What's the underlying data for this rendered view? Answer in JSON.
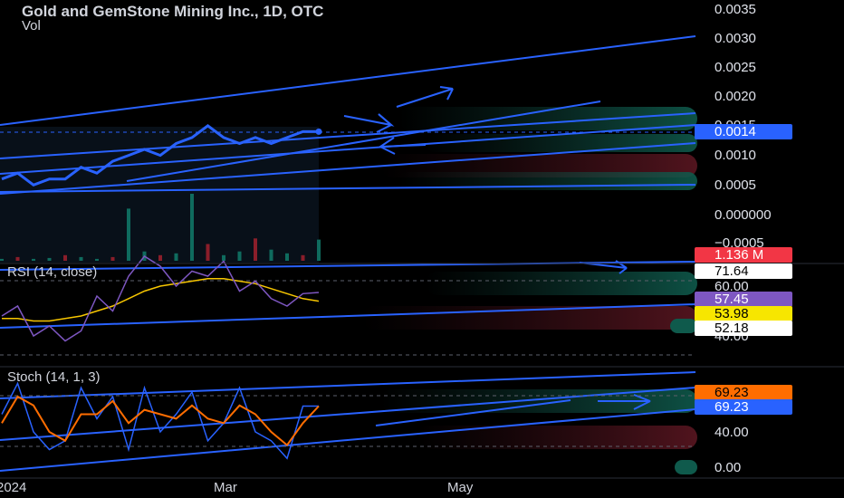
{
  "header": {
    "title": "Gold and GemStone Mining Inc., 1D, OTC",
    "vol_label": "Vol"
  },
  "indicators": {
    "rsi_label": "RSI (14, close)",
    "stoch_label": "Stoch (14, 1, 3)"
  },
  "price_axis": {
    "ticks": [
      "0.0035",
      "0.0030",
      "0.0025",
      "0.0020",
      "0.0015",
      "0.0010",
      "0.0005",
      "0.000000",
      "−0.0005"
    ]
  },
  "rsi_axis": {
    "ticks": [
      "60.00",
      "40.00"
    ]
  },
  "stoch_axis": {
    "ticks": [
      "40.00",
      "0.00"
    ]
  },
  "badges": {
    "price": {
      "text": "0.0014",
      "bg": "#2962ff",
      "fg": "#ffffff"
    },
    "volume": {
      "text": "1.136 M",
      "bg": "#f23645",
      "fg": "#ffffff"
    },
    "rsi_high": {
      "text": "71.64",
      "bg": "#ffffff",
      "fg": "#000000"
    },
    "rsi": {
      "text": "57.45",
      "bg": "#7e57c2",
      "fg": "#ffffff"
    },
    "rsi_ma": {
      "text": "53.98",
      "bg": "#f7e600",
      "fg": "#000000"
    },
    "rsi_low": {
      "text": "52.18",
      "bg": "#ffffff",
      "fg": "#000000"
    },
    "stoch_d": {
      "text": "69.23",
      "bg": "#ff6d00",
      "fg": "#000000"
    },
    "stoch_k": {
      "text": "69.23",
      "bg": "#2962ff",
      "fg": "#ffffff"
    }
  },
  "time_axis": {
    "ticks": [
      "2024",
      "Mar",
      "May"
    ]
  },
  "colors": {
    "price_line": "#2962ff",
    "rsi_line": "#7e57c2",
    "rsi_ma": "#f7c600",
    "stoch_k": "#2962ff",
    "stoch_d": "#ff6d00",
    "vol_up": "#0f6b5e",
    "vol_down": "#8a1e2a"
  },
  "chart_data": [
    {
      "type": "line",
      "name": "price",
      "x": [
        "2024-01-01",
        "2024-01-04",
        "2024-01-09",
        "2024-01-12",
        "2024-01-17",
        "2024-01-22",
        "2024-01-25",
        "2024-01-30",
        "2024-02-02",
        "2024-02-07",
        "2024-02-12",
        "2024-02-15",
        "2024-02-20",
        "2024-02-23",
        "2024-02-28",
        "2024-03-04",
        "2024-03-07",
        "2024-03-12",
        "2024-03-15",
        "2024-03-20",
        "2024-03-25"
      ],
      "values": [
        0.0006,
        0.0007,
        0.0005,
        0.0006,
        0.0006,
        0.0008,
        0.0007,
        0.0009,
        0.001,
        0.0011,
        0.001,
        0.0012,
        0.0013,
        0.0015,
        0.0013,
        0.0012,
        0.0013,
        0.0012,
        0.0013,
        0.0014,
        0.0014
      ],
      "yticks": [
        0.0035,
        0.003,
        0.0025,
        0.002,
        0.0015,
        0.001,
        0.0005,
        0.0,
        -0.0005
      ],
      "last": 0.0014
    },
    {
      "type": "bar",
      "name": "volume",
      "values": [
        0.1,
        0.2,
        0.1,
        0.15,
        0.3,
        0.2,
        0.1,
        0.2,
        2.8,
        0.5,
        0.3,
        0.4,
        3.6,
        0.9,
        0.3,
        0.5,
        1.2,
        0.6,
        0.4,
        0.3,
        1.136
      ],
      "last": 1.136
    },
    {
      "type": "line",
      "name": "RSI (14, close)",
      "values": [
        48,
        52,
        40,
        44,
        38,
        42,
        56,
        50,
        64,
        72,
        68,
        60,
        66,
        64,
        70,
        58,
        62,
        55,
        52,
        57,
        57.45
      ],
      "ma": [
        47,
        47,
        46,
        46,
        47,
        48,
        50,
        52,
        55,
        58,
        60,
        61,
        62,
        63,
        63,
        62,
        61,
        59,
        57,
        55,
        53.98
      ],
      "yticks": [
        60,
        40
      ],
      "levels": {
        "upper": 71.64,
        "lower": 52.18
      }
    },
    {
      "type": "line",
      "name": "Stoch (14, 1, 3)",
      "k": [
        60,
        95,
        40,
        20,
        30,
        90,
        55,
        80,
        20,
        90,
        40,
        60,
        85,
        30,
        50,
        90,
        40,
        30,
        10,
        69.23,
        69.23
      ],
      "d": [
        50,
        80,
        70,
        40,
        30,
        60,
        60,
        75,
        50,
        65,
        60,
        55,
        70,
        55,
        50,
        70,
        60,
        40,
        25,
        50,
        69.23
      ],
      "yticks": [
        40,
        0
      ]
    }
  ]
}
